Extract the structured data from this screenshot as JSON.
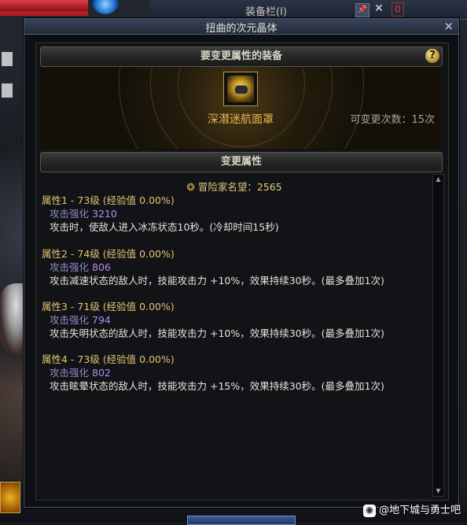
{
  "background": {
    "inventory_title": "装备栏(I)",
    "inventory_count": "0"
  },
  "window": {
    "title": "扭曲的次元晶体",
    "close_glyph": "×"
  },
  "equip_section": {
    "header": "要变更属性的装备",
    "help_glyph": "?",
    "item_name": "深潜迷航面罩",
    "change_count": "可变更次数：15次"
  },
  "attr_section": {
    "header": "变更属性",
    "fame": "冒险家名望：2565",
    "attributes": [
      {
        "title": "属性1 - 73级 (经验值 0.00%)",
        "stat_label": "攻击强化",
        "stat_value": "3210",
        "desc": "攻击时，使敌人进入冰冻状态10秒。(冷却时间15秒)"
      },
      {
        "title": "属性2 - 74级 (经验值 0.00%)",
        "stat_label": "攻击强化",
        "stat_value": "806",
        "desc": "攻击减速状态的敌人时，技能攻击力 +10%，效果持续30秒。(最多叠加1次)"
      },
      {
        "title": "属性3 - 71级 (经验值 0.00%)",
        "stat_label": "攻击强化",
        "stat_value": "794",
        "desc": "攻击失明状态的敌人时，技能攻击力 +10%，效果持续30秒。(最多叠加1次)"
      },
      {
        "title": "属性4 - 73级 (经验值 0.00%)",
        "stat_label": "攻击强化",
        "stat_value": "802",
        "desc": "攻击眩晕状态的敌人时，技能攻击力 +15%，效果持续30秒。(最多叠加1次)"
      }
    ]
  },
  "watermark": {
    "text": "@地下城与勇士吧"
  },
  "colors": {
    "item_name": "#e8b552",
    "attr_title": "#e3c476",
    "stat_value": "#b48cf2"
  },
  "icons": {
    "close": "close-icon",
    "help": "help-icon",
    "fame": "fame-icon",
    "scroll_up": "scroll-up-icon",
    "scroll_down": "scroll-down-icon"
  }
}
